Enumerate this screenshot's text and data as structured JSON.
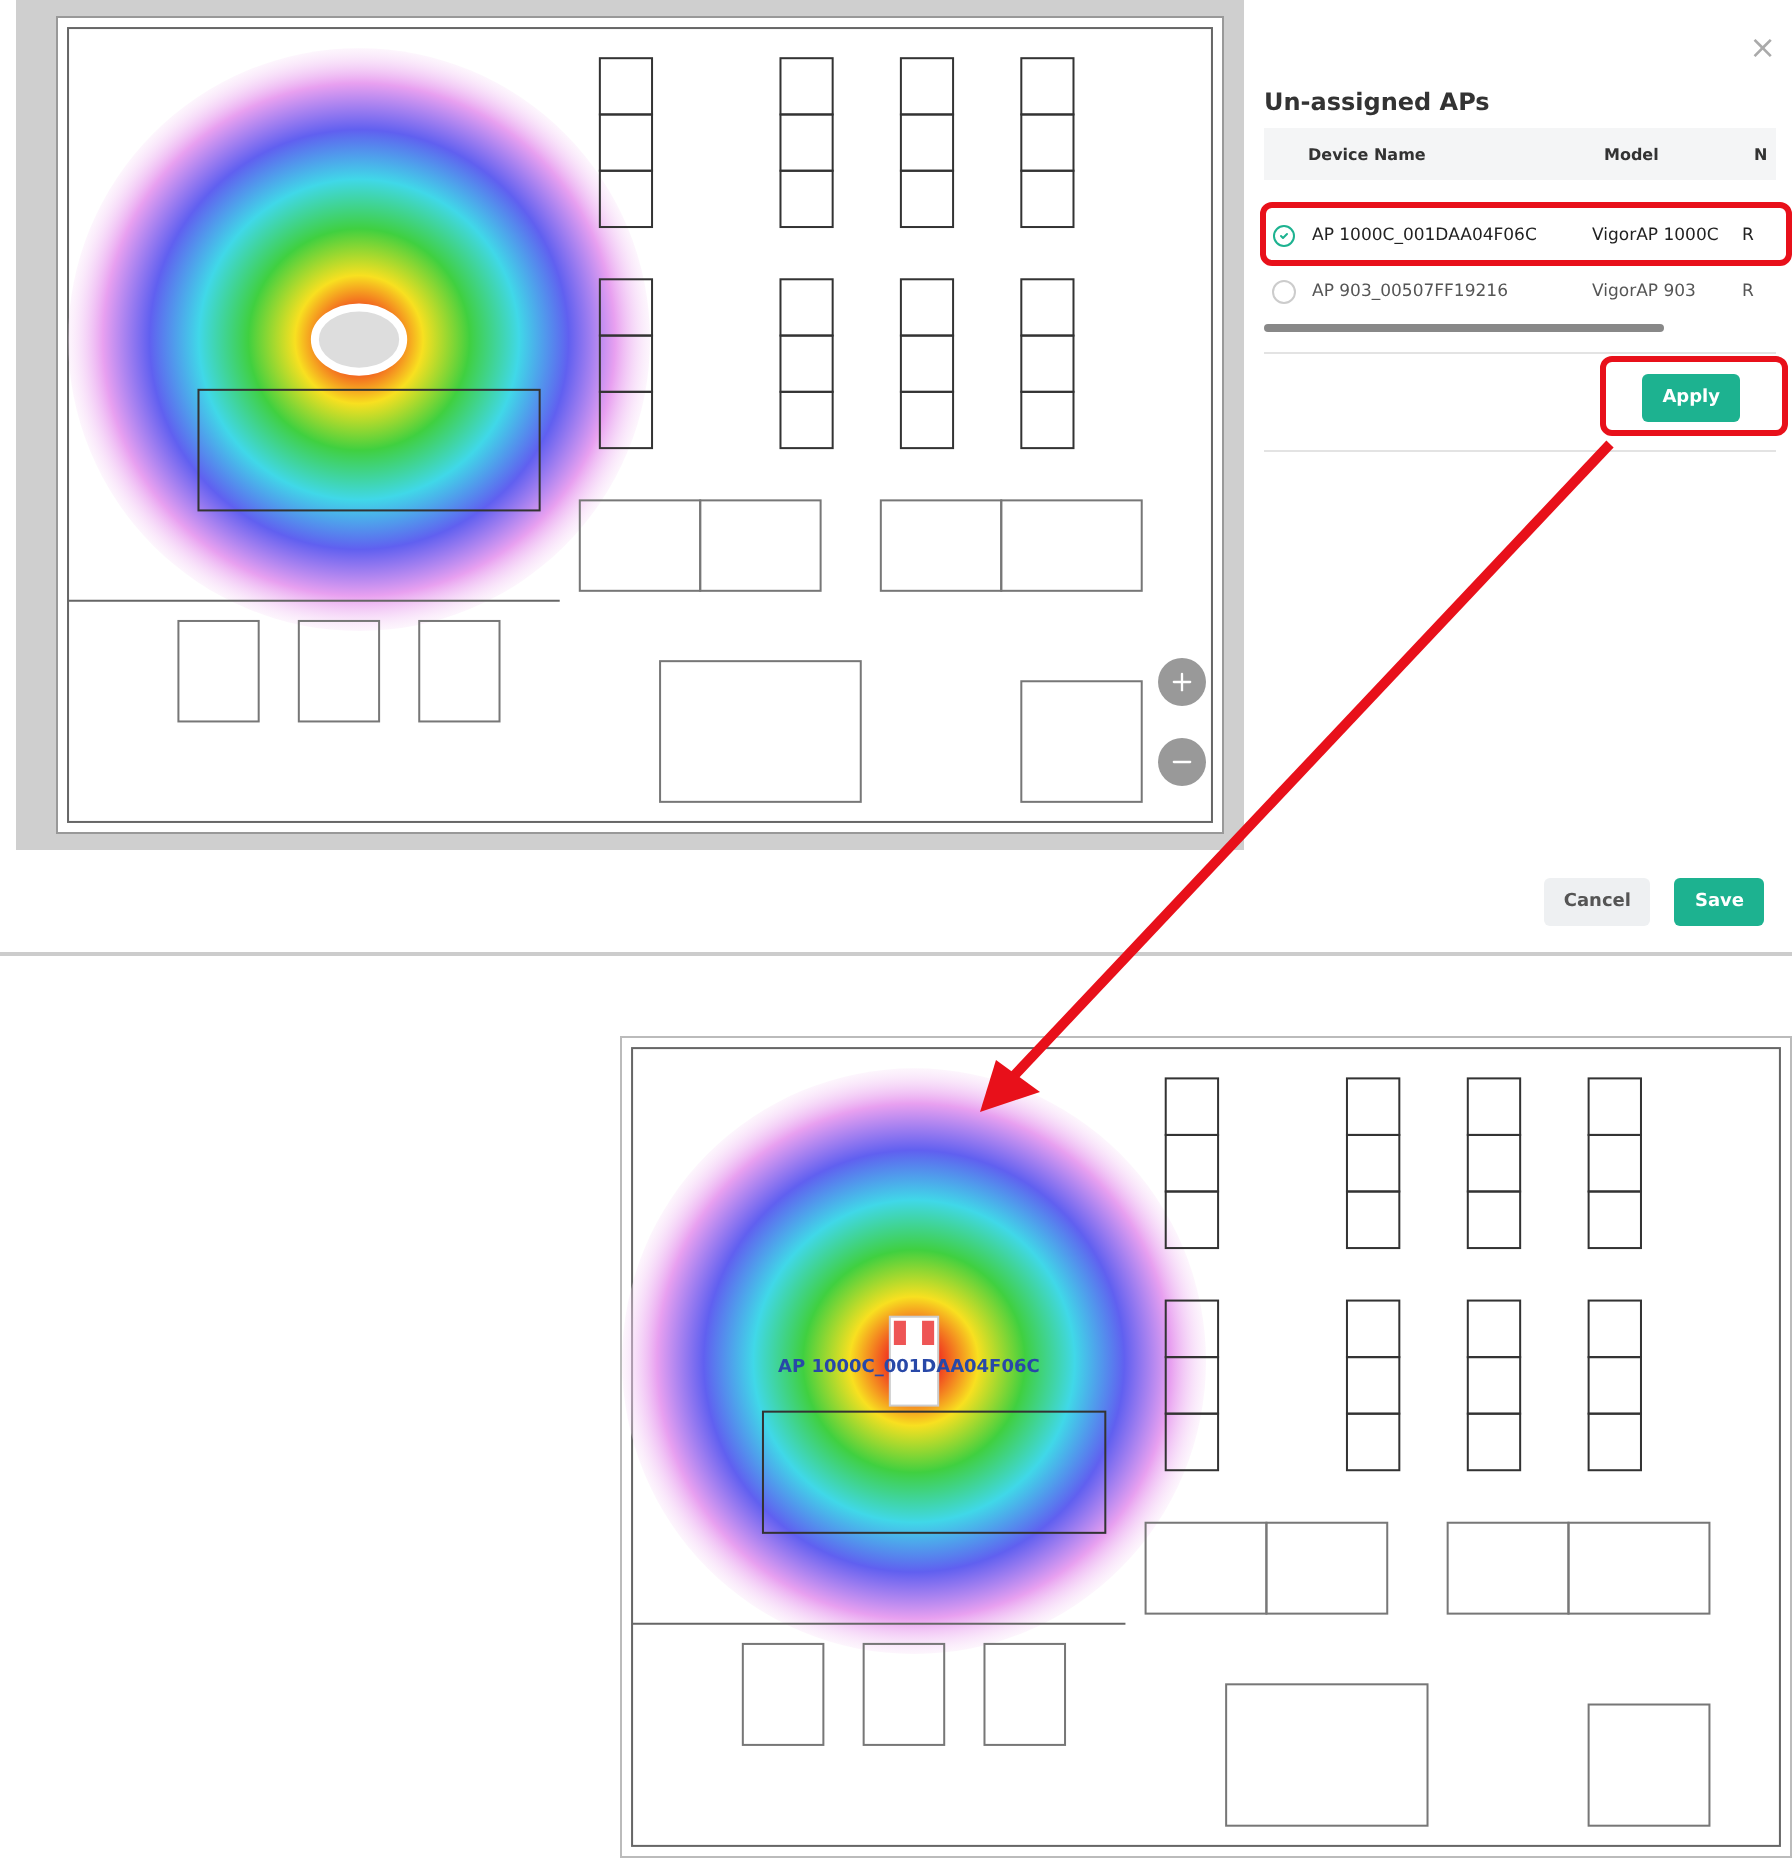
{
  "panel": {
    "close": "×",
    "title": "Un-assigned APs",
    "columns": [
      "Device Name",
      "Model",
      "N"
    ],
    "rows": [
      {
        "cells": [
          "AP 1000C_001DAA04F06C",
          "VigorAP 1000C",
          "R"
        ],
        "selected": true
      },
      {
        "cells": [
          "AP 903_00507FF19216",
          "VigorAP 903",
          "R"
        ],
        "selected": false
      }
    ],
    "apply": "Apply"
  },
  "footer": {
    "buttons": [
      {
        "label": "Cancel",
        "kind": "secondary"
      },
      {
        "label": "Save",
        "kind": "primary"
      }
    ]
  },
  "result_map": {
    "ap_label": "AP 1000C_001DAA04F06C"
  }
}
